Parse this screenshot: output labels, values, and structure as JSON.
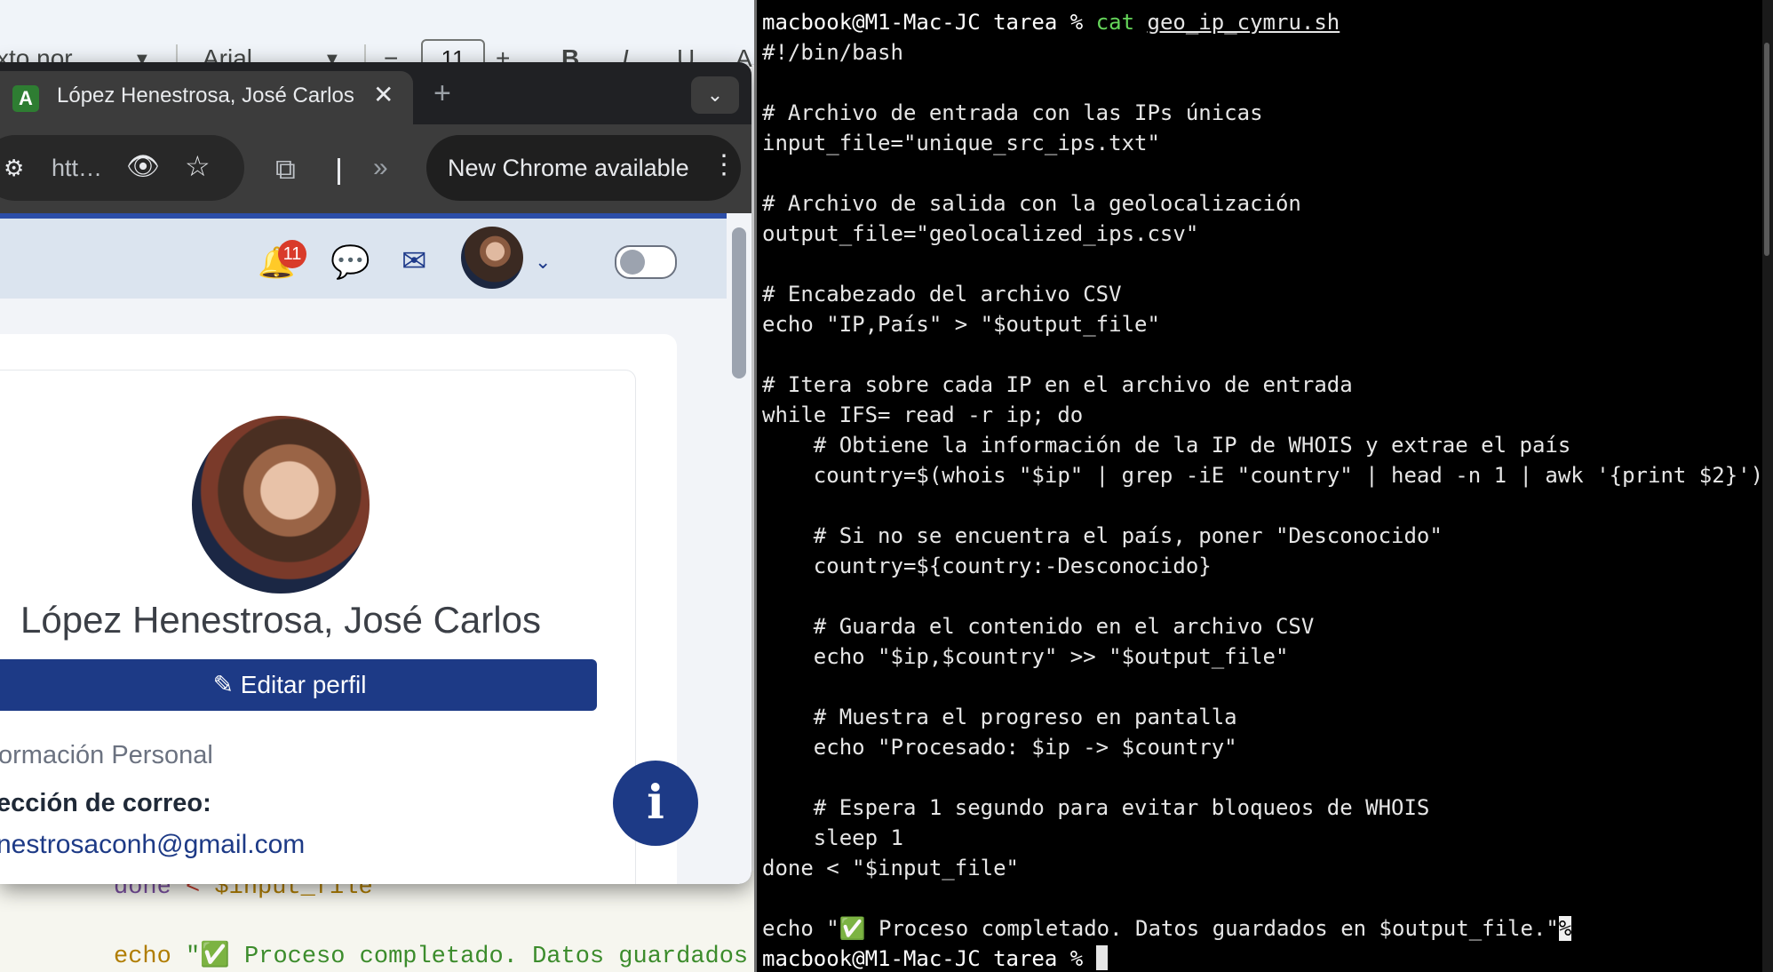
{
  "docs": {
    "style_select": "xto nor",
    "font_select": "Arial",
    "font_size": "11",
    "minus": "−",
    "plus": "+",
    "bold": "B",
    "italic": "I",
    "underline": "U",
    "text_color": "A",
    "code_line_1": {
      "keyword": "done",
      "op": " < ",
      "var": " $input_file"
    },
    "code_line_2": {
      "keyword": "echo",
      "str": " \"✅  Proceso completado. Datos guardados"
    }
  },
  "chrome": {
    "tab_title": "López Henestrosa, José Carlos",
    "tab_favicon": "A",
    "tab_close": "✕",
    "new_tab": "+",
    "tab_menu": "⌄",
    "url_text": "htt…",
    "update_label": "New Chrome available",
    "icons": {
      "tune": "⚙",
      "eye": "👁",
      "star": "☆",
      "extensions": "⧉",
      "chevrons": "»",
      "menu": "⋮"
    }
  },
  "page": {
    "notification_count": "11",
    "profile_name": "López Henestrosa, José Carlos",
    "edit_button": "✎ Editar perfil",
    "section_title": "ormación Personal",
    "email_label": "ección de correo:",
    "email_value": "nestrosaconh@gmail.com",
    "info_button": "i",
    "icons": {
      "bell": "🔔",
      "chat": "💬",
      "mail": "✉",
      "caret": "⌄"
    }
  },
  "terminal": {
    "prompt_user": "macbook@M1-Mac-JC tarea %",
    "command_name": "cat",
    "command_arg": "geo_ip_cymru.sh",
    "lines": [
      "#!/bin/bash",
      "",
      "# Archivo de entrada con las IPs únicas",
      "input_file=\"unique_src_ips.txt\"",
      "",
      "# Archivo de salida con la geolocalización",
      "output_file=\"geolocalized_ips.csv\"",
      "",
      "# Encabezado del archivo CSV",
      "echo \"IP,País\" > \"$output_file\"",
      "",
      "# Itera sobre cada IP en el archivo de entrada",
      "while IFS= read -r ip; do",
      "    # Obtiene la información de la IP de WHOIS y extrae el país",
      "    country=$(whois \"$ip\" | grep -iE \"country\" | head -n 1 | awk '{print $2}')",
      "",
      "    # Si no se encuentra el país, poner \"Desconocido\"",
      "    country=${country:-Desconocido}",
      "",
      "    # Guarda el contenido en el archivo CSV",
      "    echo \"$ip,$country\" >> \"$output_file\"",
      "",
      "    # Muestra el progreso en pantalla",
      "    echo \"Procesado: $ip -> $country\"",
      "",
      "    # Espera 1 segundo para evitar bloqueos de WHOIS",
      "    sleep 1",
      "done < \"$input_file\"",
      "",
      "echo \"✅ Proceso completado. Datos guardados en $output_file.\""
    ],
    "eof_marker": "%",
    "final_prompt": "macbook@M1-Mac-JC tarea % "
  }
}
